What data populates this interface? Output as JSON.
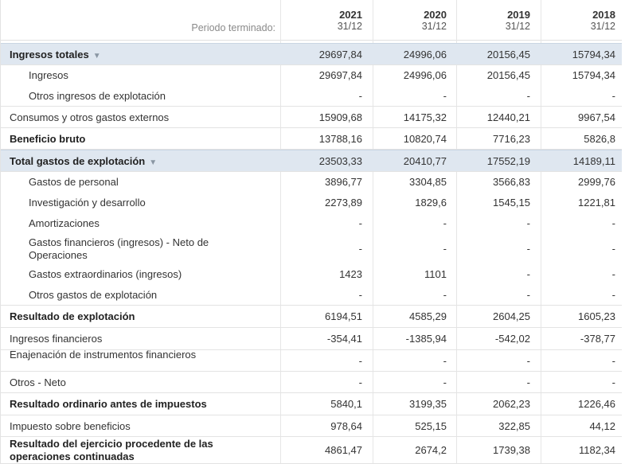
{
  "header": {
    "period_label": "Periodo terminado:",
    "years": [
      {
        "year": "2021",
        "date": "31/12"
      },
      {
        "year": "2020",
        "date": "31/12"
      },
      {
        "year": "2019",
        "date": "31/12"
      },
      {
        "year": "2018",
        "date": "31/12"
      }
    ]
  },
  "rows": [
    {
      "label": "Ingresos totales",
      "values": [
        "29697,84",
        "24996,06",
        "20156,45",
        "15794,34"
      ],
      "bold": true,
      "highlight": true,
      "caret": true
    },
    {
      "label": "Ingresos",
      "values": [
        "29697,84",
        "24996,06",
        "20156,45",
        "15794,34"
      ],
      "sub": true
    },
    {
      "label": "Otros ingresos de explotación",
      "values": [
        "-",
        "-",
        "-",
        "-"
      ],
      "sub": true
    },
    {
      "label": "Consumos y otros gastos externos",
      "values": [
        "15909,68",
        "14175,32",
        "12440,21",
        "9967,54"
      ]
    },
    {
      "label": "Beneficio bruto",
      "values": [
        "13788,16",
        "10820,74",
        "7716,23",
        "5826,8"
      ],
      "bold": true
    },
    {
      "label": "Total gastos de explotación",
      "values": [
        "23503,33",
        "20410,77",
        "17552,19",
        "14189,11"
      ],
      "bold": true,
      "highlight": true,
      "caret": true
    },
    {
      "label": "Gastos de personal",
      "values": [
        "3896,77",
        "3304,85",
        "3566,83",
        "2999,76"
      ],
      "sub": true
    },
    {
      "label": "Investigación y desarrollo",
      "values": [
        "2273,89",
        "1829,6",
        "1545,15",
        "1221,81"
      ],
      "sub": true
    },
    {
      "label": "Amortizaciones",
      "values": [
        "-",
        "-",
        "-",
        "-"
      ],
      "sub": true
    },
    {
      "label": "Gastos financieros (ingresos) - Neto de Operaciones",
      "values": [
        "-",
        "-",
        "-",
        "-"
      ],
      "sub": true
    },
    {
      "label": "Gastos extraordinarios (ingresos)",
      "values": [
        "1423",
        "1101",
        "-",
        "-"
      ],
      "sub": true
    },
    {
      "label": "Otros gastos de explotación",
      "values": [
        "-",
        "-",
        "-",
        "-"
      ],
      "sub": true
    },
    {
      "label": "Resultado de explotación",
      "values": [
        "6194,51",
        "4585,29",
        "2604,25",
        "1605,23"
      ],
      "bold": true
    },
    {
      "label": "Ingresos financieros",
      "values": [
        "-354,41",
        "-1385,94",
        "-542,02",
        "-378,77"
      ]
    },
    {
      "label": "Enajenación de instrumentos financieros",
      "values": [
        "-",
        "-",
        "-",
        "-"
      ]
    },
    {
      "label": "Otros - Neto",
      "values": [
        "-",
        "-",
        "-",
        "-"
      ]
    },
    {
      "label": "Resultado ordinario antes de impuestos",
      "values": [
        "5840,1",
        "3199,35",
        "2062,23",
        "1226,46"
      ],
      "bold": true
    },
    {
      "label": "Impuesto sobre beneficios",
      "values": [
        "978,64",
        "525,15",
        "322,85",
        "44,12"
      ]
    },
    {
      "label": "Resultado del ejercicio procedente de las operaciones continuadas",
      "values": [
        "4861,47",
        "2674,2",
        "1739,38",
        "1182,34"
      ],
      "bold": true
    }
  ]
}
